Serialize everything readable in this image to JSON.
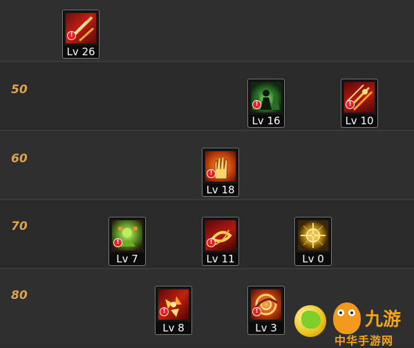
{
  "tiers": [
    {
      "label": ""
    },
    {
      "label": "50"
    },
    {
      "label": "60"
    },
    {
      "label": "70"
    },
    {
      "label": "80"
    }
  ],
  "skills": [
    {
      "level_text": "Lv 26",
      "icon": "crossed-blades-icon",
      "warning": true
    },
    {
      "level_text": "Lv 16",
      "icon": "green-figure-icon",
      "warning": true
    },
    {
      "level_text": "Lv 10",
      "icon": "fire-arrows-icon",
      "warning": true
    },
    {
      "level_text": "Lv 18",
      "icon": "golden-palm-icon",
      "warning": true
    },
    {
      "level_text": "Lv 7",
      "icon": "green-spirit-icon",
      "warning": true
    },
    {
      "level_text": "Lv 11",
      "icon": "golden-swirl-icon",
      "warning": true
    },
    {
      "level_text": "Lv 0",
      "icon": "light-burst-icon",
      "warning": false
    },
    {
      "level_text": "Lv 8",
      "icon": "fire-shards-icon",
      "warning": true
    },
    {
      "level_text": "Lv 3",
      "icon": "fire-vortex-icon",
      "warning": true
    }
  ],
  "watermark": {
    "title": "九游",
    "subtitle": "中华手游网",
    "colors": {
      "accent": "#f6a316"
    }
  },
  "colors": {
    "level_label": "#e0a54a",
    "background": "#2c2c2d"
  }
}
